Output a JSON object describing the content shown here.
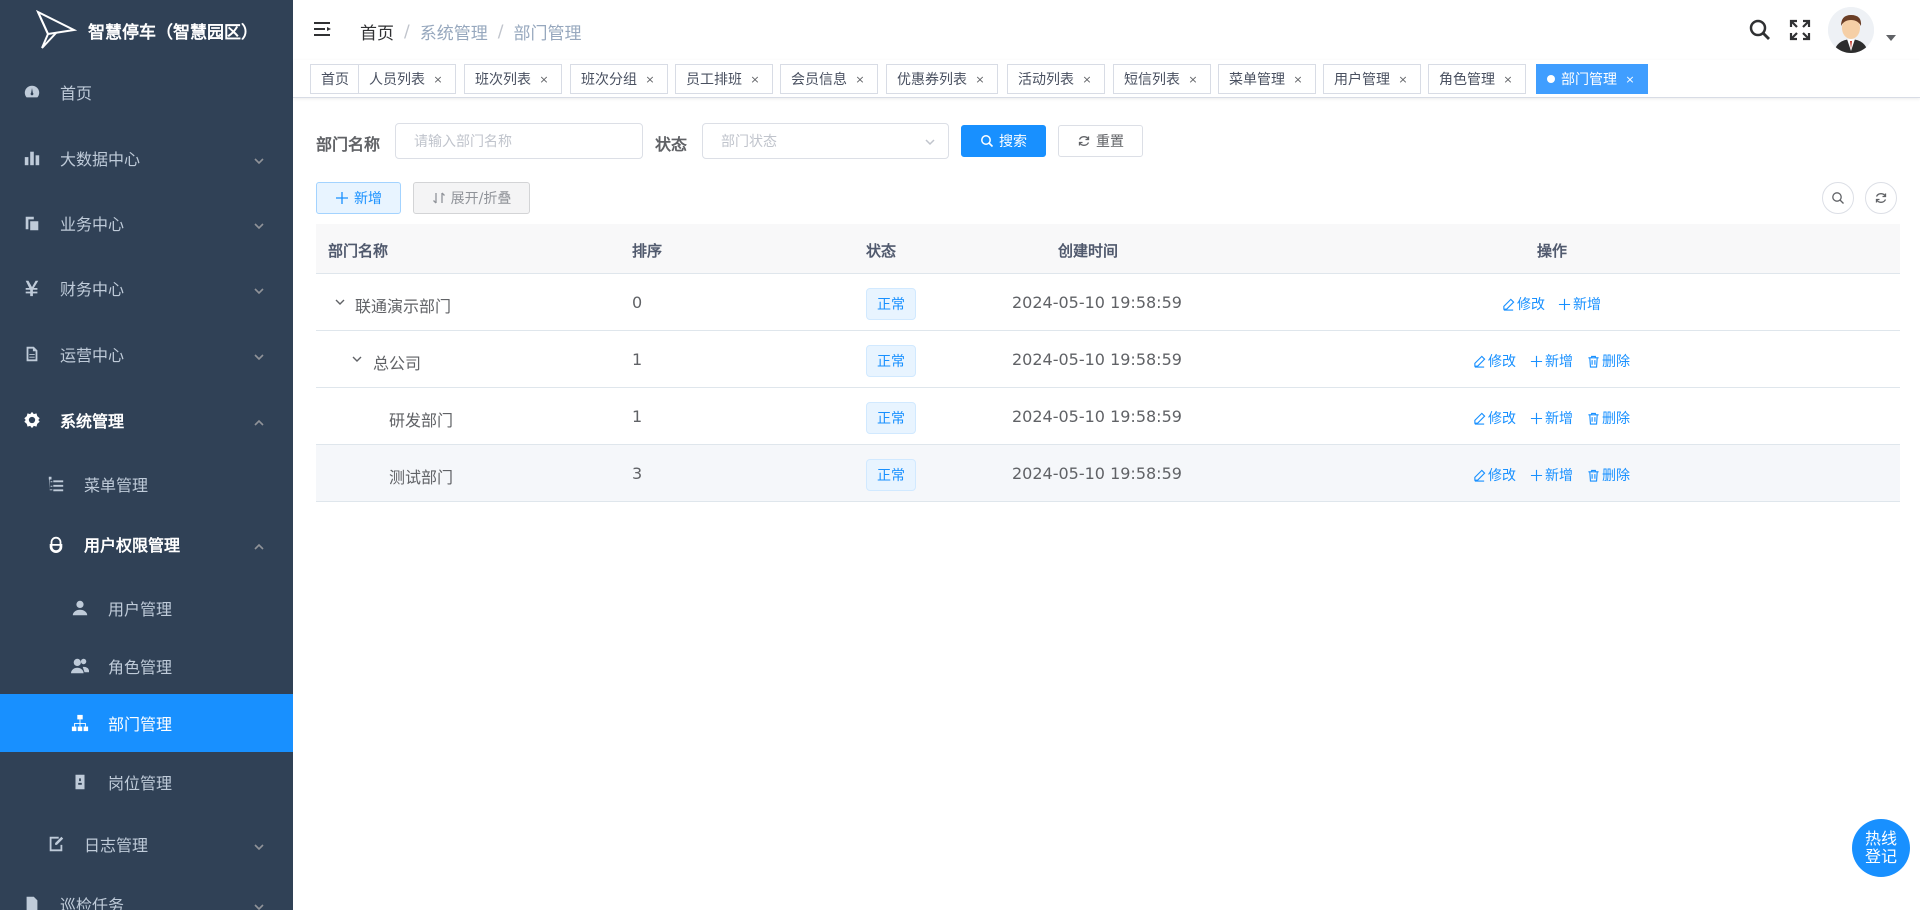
{
  "app": {
    "title": "智慧停车（智慧园区）"
  },
  "sidebar": {
    "items": [
      {
        "label": "首页",
        "icon": "dashboard-icon"
      },
      {
        "label": "大数据中心",
        "icon": "bar-chart-icon"
      },
      {
        "label": "业务中心",
        "icon": "clipboard-icon"
      },
      {
        "label": "财务中心",
        "icon": "yen-icon"
      },
      {
        "label": "运营中心",
        "icon": "document-icon"
      },
      {
        "label": "系统管理",
        "icon": "gear-icon"
      },
      {
        "label": "菜单管理",
        "icon": "tree-table-icon"
      },
      {
        "label": "用户权限管理",
        "icon": "peoples-icon"
      },
      {
        "label": "用户管理",
        "icon": "user-icon"
      },
      {
        "label": "角色管理",
        "icon": "users-icon"
      },
      {
        "label": "部门管理",
        "icon": "org-tree-icon"
      },
      {
        "label": "岗位管理",
        "icon": "post-icon"
      },
      {
        "label": "日志管理",
        "icon": "edit-doc-icon"
      },
      {
        "label": "巡检任务",
        "icon": "document-icon"
      }
    ]
  },
  "breadcrumb": {
    "home": "首页",
    "parent": "系统管理",
    "current": "部门管理"
  },
  "tags": [
    {
      "label": "首页",
      "closable": false
    },
    {
      "label": "人员列表",
      "closable": true
    },
    {
      "label": "班次列表",
      "closable": true
    },
    {
      "label": "班次分组",
      "closable": true
    },
    {
      "label": "员工排班",
      "closable": true
    },
    {
      "label": "会员信息",
      "closable": true
    },
    {
      "label": "优惠券列表",
      "closable": true
    },
    {
      "label": "活动列表",
      "closable": true
    },
    {
      "label": "短信列表",
      "closable": true
    },
    {
      "label": "菜单管理",
      "closable": true
    },
    {
      "label": "用户管理",
      "closable": true
    },
    {
      "label": "角色管理",
      "closable": true
    },
    {
      "label": "部门管理",
      "closable": true,
      "active": true
    }
  ],
  "tag_close": "×",
  "search": {
    "dept_label": "部门名称",
    "dept_placeholder": "请输入部门名称",
    "status_label": "状态",
    "status_placeholder": "部门状态",
    "search_button": "搜索",
    "reset_button": "重置"
  },
  "toolbar": {
    "add_button": "新增",
    "toggle_button": "展开/折叠"
  },
  "table": {
    "headers": {
      "name": "部门名称",
      "sort": "排序",
      "status": "状态",
      "created": "创建时间",
      "actions": "操作"
    },
    "rows": [
      {
        "name": "联通演示部门",
        "sort": "0",
        "status": "正常",
        "created": "2024-05-10 19:58:59"
      },
      {
        "name": "总公司",
        "sort": "1",
        "status": "正常",
        "created": "2024-05-10 19:58:59"
      },
      {
        "name": "研发部门",
        "sort": "1",
        "status": "正常",
        "created": "2024-05-10 19:58:59"
      },
      {
        "name": "测试部门",
        "sort": "3",
        "status": "正常",
        "created": "2024-05-10 19:58:59"
      }
    ],
    "action_edit": "修改",
    "action_add": "新增",
    "action_delete": "删除"
  },
  "float_button": {
    "line1": "热线",
    "line2": "登记"
  },
  "colors": {
    "sidebar_bg": "#304156",
    "primary": "#1890ff",
    "active_tag": "#409eff"
  }
}
